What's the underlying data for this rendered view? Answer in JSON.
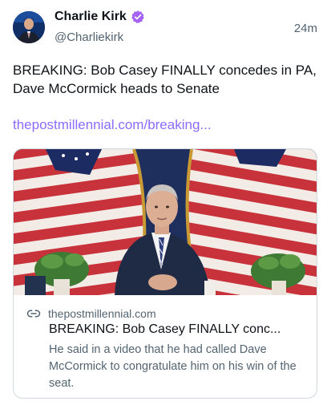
{
  "author": {
    "name": "Charlie Kirk",
    "handle": "@Charliekirk",
    "verified_color": "#a463f2"
  },
  "post": {
    "timestamp": "24m",
    "text": "BREAKING: Bob Casey FINALLY concedes in PA, Dave McCormick heads to Senate",
    "link_text": "thepostmillennial.com/breaking...",
    "link_color": "#8c6bff"
  },
  "card": {
    "domain": "thepostmillennial.com",
    "title": "BREAKING: Bob Casey FINALLY conc...",
    "description": "He said in a video that he had called Dave McCormick to congratulate him on his win of the seat.",
    "image_icon": "man-at-podium-with-flags-photo"
  }
}
